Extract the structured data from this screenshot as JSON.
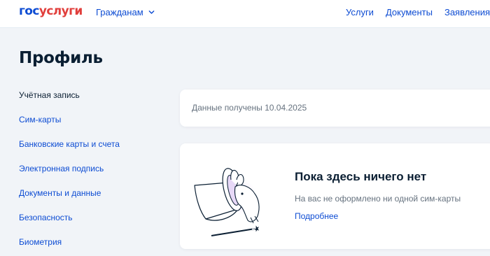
{
  "header": {
    "logo_part1": "гос",
    "logo_part2": "услуги",
    "audience_label": "Гражданам",
    "nav": [
      "Услуги",
      "Документы",
      "Заявления"
    ]
  },
  "page": {
    "title": "Профиль"
  },
  "sidebar": {
    "items": [
      {
        "label": "Учётная запись",
        "active": true
      },
      {
        "label": "Сим-карты",
        "active": false
      },
      {
        "label": "Банковские карты и счета",
        "active": false
      },
      {
        "label": "Электронная подпись",
        "active": false
      },
      {
        "label": "Документы и данные",
        "active": false
      },
      {
        "label": "Безопасность",
        "active": false
      },
      {
        "label": "Биометрия",
        "active": false
      }
    ]
  },
  "info_card": {
    "text": "Данные получены 10.04.2025"
  },
  "empty_state": {
    "title": "Пока здесь ничего нет",
    "subtitle": "На вас не оформлено ни одной сим-карты",
    "link": "Подробнее"
  },
  "colors": {
    "brand_blue": "#0d4cd3",
    "brand_red": "#e13f3c",
    "text_primary": "#0b1f33",
    "text_secondary": "#66727f",
    "page_bg": "#f1f4f8"
  }
}
